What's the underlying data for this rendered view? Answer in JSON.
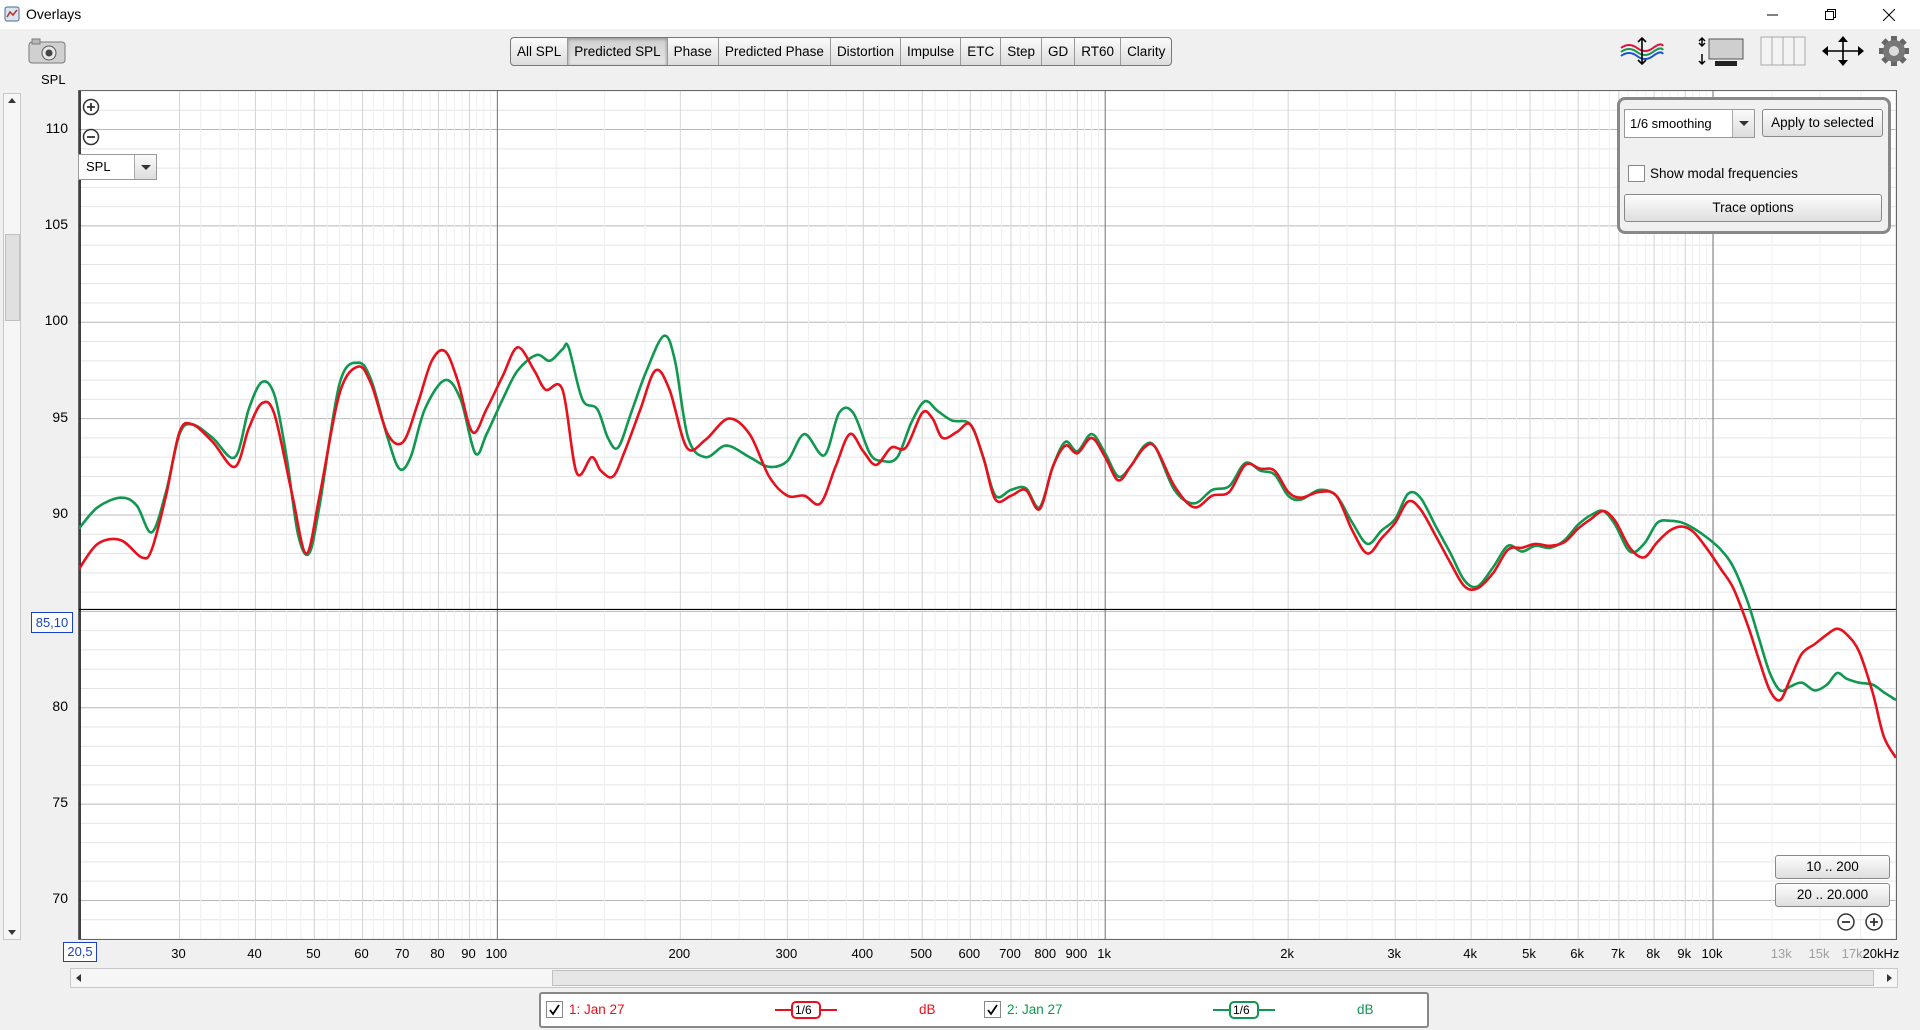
{
  "window": {
    "title": "Overlays"
  },
  "left_toolbar": {
    "spl_label": "SPL"
  },
  "tabs": [
    {
      "label": "All SPL",
      "active": false
    },
    {
      "label": "Predicted SPL",
      "active": true
    },
    {
      "label": "Phase",
      "active": false
    },
    {
      "label": "Predicted Phase",
      "active": false
    },
    {
      "label": "Distortion",
      "active": false
    },
    {
      "label": "Impulse",
      "active": false
    },
    {
      "label": "ETC",
      "active": false
    },
    {
      "label": "Step",
      "active": false
    },
    {
      "label": "GD",
      "active": false
    },
    {
      "label": "RT60",
      "active": false
    },
    {
      "label": "Clarity",
      "active": false
    }
  ],
  "graph": {
    "measure_select": "SPL",
    "cursor_y_value": "85,10",
    "cursor_x_value": "20,5"
  },
  "controls_panel": {
    "smoothing_select": "1/6 smoothing",
    "apply_label": "Apply to selected",
    "modal_label": "Show modal frequencies",
    "modal_checked": false,
    "trace_options_label": "Trace options"
  },
  "range_buttons": {
    "btn1": "10 .. 200",
    "btn2": "20 .. 20.000"
  },
  "legend": {
    "items": [
      {
        "checked": true,
        "label": "1: Jan 27",
        "smoothing": "1/6",
        "unit": "dB",
        "color": "#e8101c"
      },
      {
        "checked": true,
        "label": "2: Jan 27",
        "smoothing": "1/6",
        "unit": "dB",
        "color": "#109850"
      }
    ]
  },
  "chart_data": {
    "type": "line",
    "xscale": "log",
    "xlim": [
      20.5,
      20000
    ],
    "ylim": [
      68,
      112
    ],
    "y_ticks": [
      70,
      75,
      80,
      85,
      90,
      95,
      100,
      105,
      110
    ],
    "x_tick_labels": [
      {
        "f": 30,
        "label": "30"
      },
      {
        "f": 40,
        "label": "40"
      },
      {
        "f": 50,
        "label": "50"
      },
      {
        "f": 60,
        "label": "60"
      },
      {
        "f": 70,
        "label": "70"
      },
      {
        "f": 80,
        "label": "80"
      },
      {
        "f": 90,
        "label": "90"
      },
      {
        "f": 100,
        "label": "100"
      },
      {
        "f": 200,
        "label": "200"
      },
      {
        "f": 300,
        "label": "300"
      },
      {
        "f": 400,
        "label": "400"
      },
      {
        "f": 500,
        "label": "500"
      },
      {
        "f": 600,
        "label": "600"
      },
      {
        "f": 700,
        "label": "700"
      },
      {
        "f": 800,
        "label": "800"
      },
      {
        "f": 900,
        "label": "900"
      },
      {
        "f": 1000,
        "label": "1k"
      },
      {
        "f": 2000,
        "label": "2k"
      },
      {
        "f": 3000,
        "label": "3k"
      },
      {
        "f": 4000,
        "label": "4k"
      },
      {
        "f": 5000,
        "label": "5k"
      },
      {
        "f": 6000,
        "label": "6k"
      },
      {
        "f": 7000,
        "label": "7k"
      },
      {
        "f": 8000,
        "label": "8k"
      },
      {
        "f": 9000,
        "label": "9k"
      },
      {
        "f": 10000,
        "label": "10k"
      },
      {
        "f": 13000,
        "label": "13k",
        "dim": true
      },
      {
        "f": 15000,
        "label": "15k",
        "dim": true
      },
      {
        "f": 17000,
        "label": "17k",
        "dim": true
      },
      {
        "f": 20000,
        "label": "20kHz"
      }
    ],
    "cursor": {
      "x": 20.5,
      "y": 85.1
    },
    "series": [
      {
        "name": "1: Jan 27",
        "color": "#e8101c",
        "points": [
          [
            20.5,
            87.2
          ],
          [
            22,
            88.5
          ],
          [
            24,
            88.7
          ],
          [
            26,
            87.8
          ],
          [
            27,
            88.2
          ],
          [
            28.5,
            91
          ],
          [
            30,
            94.3
          ],
          [
            31.5,
            94.7
          ],
          [
            34,
            93.8
          ],
          [
            37,
            92.5
          ],
          [
            39,
            94.5
          ],
          [
            41,
            95.8
          ],
          [
            43,
            95.2
          ],
          [
            46,
            91
          ],
          [
            48.5,
            88
          ],
          [
            51,
            91
          ],
          [
            55,
            96.3
          ],
          [
            59,
            97.7
          ],
          [
            62,
            96.8
          ],
          [
            66,
            94.2
          ],
          [
            70,
            93.8
          ],
          [
            74,
            95.8
          ],
          [
            78,
            98
          ],
          [
            82,
            98.5
          ],
          [
            86,
            97
          ],
          [
            91,
            94.3
          ],
          [
            96,
            95.5
          ],
          [
            102,
            97.2
          ],
          [
            108,
            98.7
          ],
          [
            115,
            97.5
          ],
          [
            120,
            96.5
          ],
          [
            128,
            96.5
          ],
          [
            135,
            92.2
          ],
          [
            143,
            93
          ],
          [
            148,
            92.3
          ],
          [
            155,
            92
          ],
          [
            162,
            93.3
          ],
          [
            172,
            95.5
          ],
          [
            182,
            97.5
          ],
          [
            192,
            96.5
          ],
          [
            205,
            93.5
          ],
          [
            220,
            93.9
          ],
          [
            240,
            95
          ],
          [
            260,
            94.2
          ],
          [
            280,
            92
          ],
          [
            300,
            91
          ],
          [
            320,
            91
          ],
          [
            340,
            90.6
          ],
          [
            360,
            92.5
          ],
          [
            380,
            94.2
          ],
          [
            400,
            93.3
          ],
          [
            420,
            92.6
          ],
          [
            445,
            93.5
          ],
          [
            470,
            93.5
          ],
          [
            500,
            95.3
          ],
          [
            520,
            95
          ],
          [
            540,
            94
          ],
          [
            570,
            94.3
          ],
          [
            600,
            94.7
          ],
          [
            630,
            93
          ],
          [
            660,
            90.8
          ],
          [
            700,
            91
          ],
          [
            740,
            91.3
          ],
          [
            780,
            90.3
          ],
          [
            820,
            92.5
          ],
          [
            860,
            93.6
          ],
          [
            900,
            93.2
          ],
          [
            950,
            94
          ],
          [
            1000,
            93
          ],
          [
            1050,
            91.8
          ],
          [
            1100,
            92.5
          ],
          [
            1160,
            93.5
          ],
          [
            1210,
            93.5
          ],
          [
            1300,
            91.5
          ],
          [
            1400,
            90.4
          ],
          [
            1500,
            91
          ],
          [
            1600,
            91.2
          ],
          [
            1700,
            92.6
          ],
          [
            1800,
            92.4
          ],
          [
            1900,
            92.3
          ],
          [
            2000,
            91.2
          ],
          [
            2100,
            90.9
          ],
          [
            2250,
            91.2
          ],
          [
            2400,
            91
          ],
          [
            2550,
            89.2
          ],
          [
            2700,
            88
          ],
          [
            2850,
            88.8
          ],
          [
            3000,
            89.6
          ],
          [
            3150,
            90.7
          ],
          [
            3300,
            90.3
          ],
          [
            3500,
            88.9
          ],
          [
            3700,
            87.5
          ],
          [
            3900,
            86.3
          ],
          [
            4100,
            86.2
          ],
          [
            4350,
            87
          ],
          [
            4600,
            88.2
          ],
          [
            4850,
            88.3
          ],
          [
            5100,
            88.5
          ],
          [
            5400,
            88.4
          ],
          [
            5700,
            88.6
          ],
          [
            6000,
            89.3
          ],
          [
            6300,
            89.8
          ],
          [
            6600,
            90.2
          ],
          [
            6900,
            89.7
          ],
          [
            7300,
            88.3
          ],
          [
            7700,
            87.8
          ],
          [
            8100,
            88.6
          ],
          [
            8500,
            89.2
          ],
          [
            8900,
            89.4
          ],
          [
            9300,
            89.1
          ],
          [
            9800,
            88.2
          ],
          [
            10300,
            87.2
          ],
          [
            10800,
            86.2
          ],
          [
            11400,
            84.3
          ],
          [
            11900,
            82.5
          ],
          [
            12400,
            80.9
          ],
          [
            12900,
            80.4
          ],
          [
            13400,
            81.5
          ],
          [
            14000,
            82.8
          ],
          [
            14700,
            83.3
          ],
          [
            15400,
            83.8
          ],
          [
            16000,
            84.1
          ],
          [
            16600,
            83.8
          ],
          [
            17400,
            82.9
          ],
          [
            18300,
            80.8
          ],
          [
            19100,
            78.5
          ],
          [
            20000,
            77.4
          ]
        ]
      },
      {
        "name": "2: Jan 27",
        "color": "#109850",
        "points": [
          [
            20.5,
            89.3
          ],
          [
            22,
            90.4
          ],
          [
            24,
            90.9
          ],
          [
            25.5,
            90.5
          ],
          [
            27,
            89.1
          ],
          [
            28.5,
            91.2
          ],
          [
            30,
            94.2
          ],
          [
            31.5,
            94.7
          ],
          [
            34,
            94
          ],
          [
            37,
            93
          ],
          [
            39,
            95.5
          ],
          [
            41,
            96.9
          ],
          [
            43,
            96.2
          ],
          [
            45,
            93
          ],
          [
            47,
            89
          ],
          [
            49,
            88
          ],
          [
            51,
            90.5
          ],
          [
            55,
            96.8
          ],
          [
            59,
            97.9
          ],
          [
            62,
            97
          ],
          [
            66,
            94
          ],
          [
            69,
            92.4
          ],
          [
            72,
            93
          ],
          [
            76,
            95.5
          ],
          [
            82,
            97
          ],
          [
            87,
            96
          ],
          [
            92,
            93.2
          ],
          [
            96,
            94.2
          ],
          [
            102,
            96
          ],
          [
            108,
            97.5
          ],
          [
            116,
            98.3
          ],
          [
            122,
            98
          ],
          [
            128,
            98.6
          ],
          [
            131,
            98.7
          ],
          [
            138,
            96
          ],
          [
            146,
            95.5
          ],
          [
            152,
            94
          ],
          [
            158,
            93.5
          ],
          [
            166,
            95.3
          ],
          [
            176,
            97.5
          ],
          [
            188,
            99.3
          ],
          [
            196,
            98
          ],
          [
            206,
            94
          ],
          [
            220,
            93
          ],
          [
            238,
            93.6
          ],
          [
            260,
            93
          ],
          [
            280,
            92.5
          ],
          [
            300,
            92.8
          ],
          [
            320,
            94.2
          ],
          [
            345,
            93.1
          ],
          [
            365,
            95.3
          ],
          [
            385,
            95.3
          ],
          [
            410,
            93.2
          ],
          [
            430,
            92.8
          ],
          [
            455,
            93
          ],
          [
            480,
            94.8
          ],
          [
            505,
            95.9
          ],
          [
            530,
            95.4
          ],
          [
            560,
            94.9
          ],
          [
            600,
            94.7
          ],
          [
            630,
            93
          ],
          [
            660,
            91
          ],
          [
            700,
            91.3
          ],
          [
            740,
            91.4
          ],
          [
            780,
            90.4
          ],
          [
            820,
            92.5
          ],
          [
            860,
            93.8
          ],
          [
            900,
            93.3
          ],
          [
            950,
            94.2
          ],
          [
            1000,
            93.2
          ],
          [
            1050,
            92
          ],
          [
            1100,
            92.5
          ],
          [
            1160,
            93.6
          ],
          [
            1210,
            93.5
          ],
          [
            1300,
            91.3
          ],
          [
            1400,
            90.6
          ],
          [
            1500,
            91.3
          ],
          [
            1600,
            91.5
          ],
          [
            1700,
            92.7
          ],
          [
            1800,
            92.3
          ],
          [
            1900,
            92.1
          ],
          [
            2000,
            91
          ],
          [
            2100,
            90.8
          ],
          [
            2250,
            91.3
          ],
          [
            2400,
            91
          ],
          [
            2550,
            89.6
          ],
          [
            2700,
            88.5
          ],
          [
            2850,
            89.2
          ],
          [
            3000,
            89.8
          ],
          [
            3150,
            91.1
          ],
          [
            3300,
            90.9
          ],
          [
            3500,
            89.4
          ],
          [
            3700,
            88
          ],
          [
            3900,
            86.6
          ],
          [
            4100,
            86.3
          ],
          [
            4350,
            87.3
          ],
          [
            4600,
            88.4
          ],
          [
            4850,
            88.1
          ],
          [
            5100,
            88.4
          ],
          [
            5400,
            88.3
          ],
          [
            5700,
            88.7
          ],
          [
            6000,
            89.5
          ],
          [
            6300,
            90
          ],
          [
            6600,
            90.2
          ],
          [
            6900,
            89.5
          ],
          [
            7300,
            88.1
          ],
          [
            7700,
            88.5
          ],
          [
            8100,
            89.6
          ],
          [
            8500,
            89.7
          ],
          [
            8900,
            89.6
          ],
          [
            9300,
            89.3
          ],
          [
            9800,
            88.8
          ],
          [
            10300,
            88.2
          ],
          [
            10800,
            87.3
          ],
          [
            11400,
            85.5
          ],
          [
            11900,
            83.6
          ],
          [
            12400,
            81.8
          ],
          [
            12900,
            80.9
          ],
          [
            13400,
            81.1
          ],
          [
            14000,
            81.3
          ],
          [
            14700,
            80.9
          ],
          [
            15400,
            81.2
          ],
          [
            16000,
            81.8
          ],
          [
            16600,
            81.5
          ],
          [
            17400,
            81.3
          ],
          [
            18300,
            81.2
          ],
          [
            19100,
            80.8
          ],
          [
            20000,
            80.4
          ]
        ]
      }
    ]
  }
}
